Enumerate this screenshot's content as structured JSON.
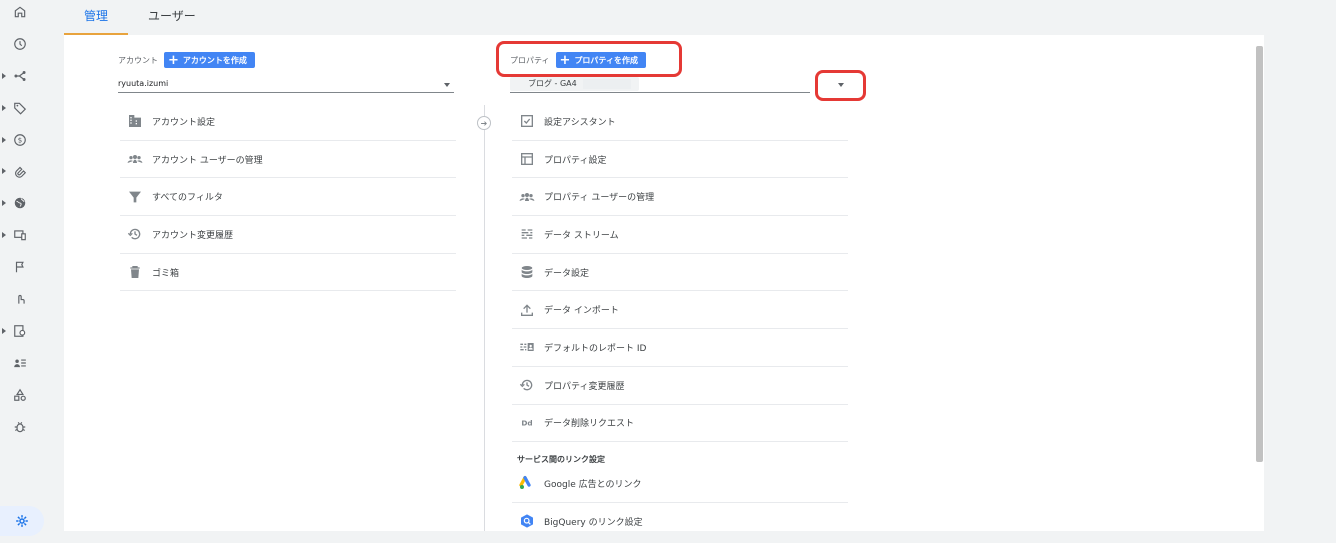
{
  "tabs": [
    {
      "label": "管理",
      "active": true
    },
    {
      "label": "ユーザー",
      "active": false
    }
  ],
  "account": {
    "header_label": "アカウント",
    "create_button": "アカウントを作成",
    "selected": "ryuuta.izumi",
    "menu": [
      {
        "label": "アカウント設定",
        "icon": "building-icon"
      },
      {
        "label": "アカウント ユーザーの管理",
        "icon": "people-icon"
      },
      {
        "label": "すべてのフィルタ",
        "icon": "filter-icon"
      },
      {
        "label": "アカウント変更履歴",
        "icon": "history-icon"
      },
      {
        "label": "ゴミ箱",
        "icon": "trash-icon"
      }
    ]
  },
  "property": {
    "header_label": "プロパティ",
    "create_button": "プロパティを作成",
    "selected": "ブログ - GA4",
    "menu": [
      {
        "label": "設定アシスタント",
        "icon": "checklist-icon"
      },
      {
        "label": "プロパティ設定",
        "icon": "window-icon"
      },
      {
        "label": "プロパティ ユーザーの管理",
        "icon": "people-icon"
      },
      {
        "label": "データ ストリーム",
        "icon": "streams-icon"
      },
      {
        "label": "データ設定",
        "icon": "database-icon"
      },
      {
        "label": "データ インポート",
        "icon": "upload-icon"
      },
      {
        "label": "デフォルトのレポート ID",
        "icon": "report-id-icon"
      },
      {
        "label": "プロパティ変更履歴",
        "icon": "history-icon"
      },
      {
        "label": "データ削除リクエスト",
        "icon": "dd-icon"
      }
    ],
    "links_section_title": "サービス間のリンク設定",
    "links": [
      {
        "label": "Google 広告とのリンク",
        "icon": "google-ads-icon"
      },
      {
        "label": "BigQuery のリンク設定",
        "icon": "bigquery-icon"
      }
    ]
  },
  "colors": {
    "accent": "#1a73e8",
    "button": "#4285f4",
    "highlight": "#e53935",
    "tab_underline": "#e8a33d"
  }
}
